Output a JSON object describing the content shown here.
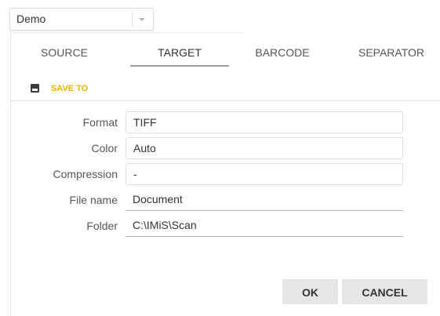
{
  "profile_select": {
    "value": "Demo"
  },
  "tabs": [
    {
      "label": "SOURCE",
      "active": false
    },
    {
      "label": "TARGET",
      "active": true
    },
    {
      "label": "BARCODE",
      "active": false
    },
    {
      "label": "SEPARATOR",
      "active": false
    }
  ],
  "section": {
    "title": "SAVE TO",
    "icon": "save-icon",
    "accent_color": "#f0b400"
  },
  "fields": {
    "format": {
      "label": "Format",
      "value": "TIFF"
    },
    "color": {
      "label": "Color",
      "value": "Auto"
    },
    "compression": {
      "label": "Compression",
      "value": "-"
    },
    "file_name": {
      "label": "File name",
      "value": "Document"
    },
    "folder": {
      "label": "Folder",
      "value": "C:\\IMiS\\Scan"
    }
  },
  "buttons": {
    "ok": "OK",
    "cancel": "CANCEL"
  }
}
